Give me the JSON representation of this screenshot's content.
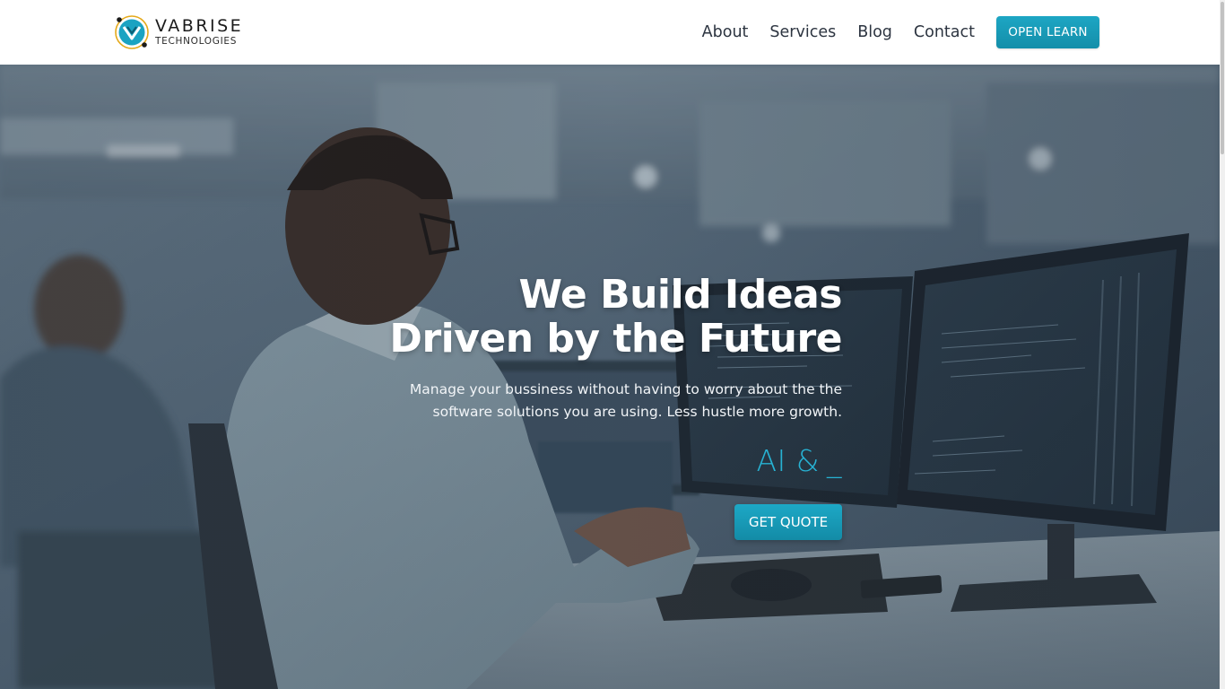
{
  "colors": {
    "accent": "#1a9fbd",
    "typed_text": "#27b2d3",
    "header_bg": "#ffffff",
    "nav_text": "#2c3440"
  },
  "brand": {
    "name": "VABRISE",
    "tagline": "TECHNOLOGIES",
    "logo_icon": "vabrise-logo-icon"
  },
  "nav": {
    "items": [
      {
        "label": "About"
      },
      {
        "label": "Services"
      },
      {
        "label": "Blog"
      },
      {
        "label": "Contact"
      }
    ],
    "cta_label": "OPEN LEARN"
  },
  "hero": {
    "title_line1": "We Build Ideas",
    "title_line2": "Driven by the Future",
    "subtitle_line1": "Manage your bussiness without having to worry about the the",
    "subtitle_line2": "software solutions you are using. Less hustle more growth.",
    "typed_text": "AI &",
    "typed_cursor": "_",
    "cta_label": "GET QUOTE",
    "background_icon": "office-developers-photo"
  }
}
